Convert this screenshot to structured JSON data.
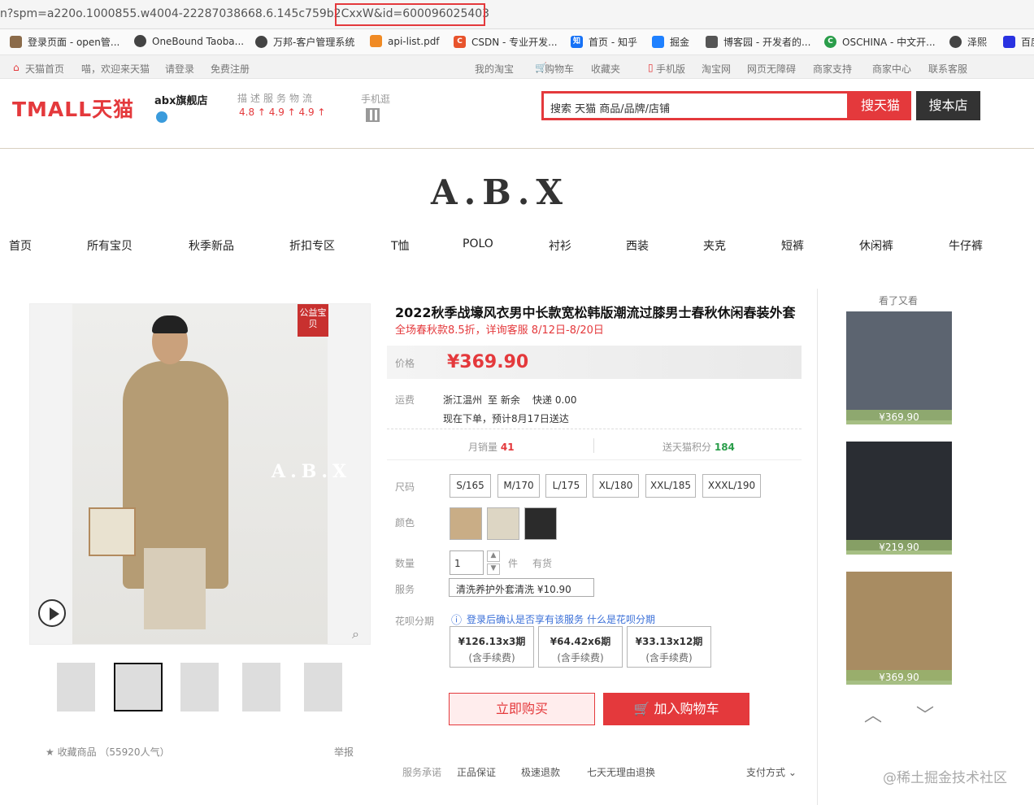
{
  "browser": {
    "url": "n?spm=a220o.1000855.w4004-22287038668.6.145c759b2CxxW&id=600096025403"
  },
  "bookmarks": [
    "登录页面 - open管...",
    "OneBound Taoba...",
    "万邦-客户管理系统",
    "api-list.pdf",
    "CSDN - 专业开发...",
    "首页 - 知乎",
    "掘金",
    "博客园 - 开发者的...",
    "OSCHINA - 中文开...",
    "泽熙",
    "百度"
  ],
  "topbar": {
    "home": "天猫首页",
    "welcome": "喵，欢迎来天猫",
    "login": "请登录",
    "register": "免费注册",
    "my": "我的淘宝",
    "cart": "购物车",
    "fav": "收藏夹",
    "mobile": "手机版",
    "taobao": "淘宝网",
    "access": "网页无障碍",
    "merchant": "商家支持",
    "center": "商家中心",
    "contact": "联系客服"
  },
  "header": {
    "logo": "TMALL天猫",
    "shop": "abx旗舰店",
    "score_labels": "描述服务物流",
    "scores": "4.8 ↑ 4.9 ↑ 4.9 ↑",
    "mobile": "手机逛",
    "search_placeholder": "搜索 天猫 商品/品牌/店铺",
    "search_tmall": "搜天猫",
    "search_shop": "搜本店"
  },
  "brand": "A.B.X",
  "nav": [
    "首页",
    "所有宝贝",
    "秋季新品",
    "折扣专区",
    "T恤",
    "POLO",
    "衬衫",
    "西装",
    "夹克",
    "短裤",
    "休闲裤",
    "牛仔裤"
  ],
  "gallery": {
    "flag": "公益宝贝",
    "watermark": "A.B.X",
    "fav": "收藏商品 （55920人气）",
    "report": "举报"
  },
  "product": {
    "title": "2022秋季战壕风衣男中长款宽松韩版潮流过膝男士春秋休闲春装外套",
    "promo": "全场春秋款8.5折，详询客服 8/12日-8/20日",
    "price_label": "价格",
    "price": "¥369.90",
    "ship_label": "运费",
    "ship_from": "浙江温州",
    "ship_to": "至 新余",
    "ship_fee": "快递 0.00",
    "ship_eta": "现在下单，预计8月17日送达",
    "monthly_label": "月销量",
    "monthly": "41",
    "points_label": "送天猫积分",
    "points": "184",
    "size_label": "尺码",
    "sizes": [
      "S/165",
      "M/170",
      "L/175",
      "XL/180",
      "XXL/185",
      "XXXL/190"
    ],
    "color_label": "颜色",
    "qty_label": "数量",
    "qty": "1",
    "qty_unit": "件",
    "stock": "有货",
    "service_label": "服务",
    "service": "清洗养护外套清洗 ¥10.90",
    "huabei_label": "花呗分期",
    "huabei_note": "登录后确认是否享有该服务",
    "huabei_link": "什么是花呗分期",
    "installments": [
      {
        "price": "¥126.13x3期",
        "fee": "(含手续费)"
      },
      {
        "price": "¥64.42x6期",
        "fee": "(含手续费)"
      },
      {
        "price": "¥33.13x12期",
        "fee": "(含手续费)"
      }
    ],
    "buy": "立即购买",
    "cart": "加入购物车",
    "promise_label": "服务承诺",
    "promises": [
      "正品保证",
      "极速退款",
      "七天无理由退换"
    ],
    "pay": "支付方式"
  },
  "sidebar": {
    "title": "看了又看",
    "prices": [
      "¥369.90",
      "¥219.90",
      "¥369.90"
    ]
  },
  "footer_watermark": "@稀土掘金技术社区"
}
